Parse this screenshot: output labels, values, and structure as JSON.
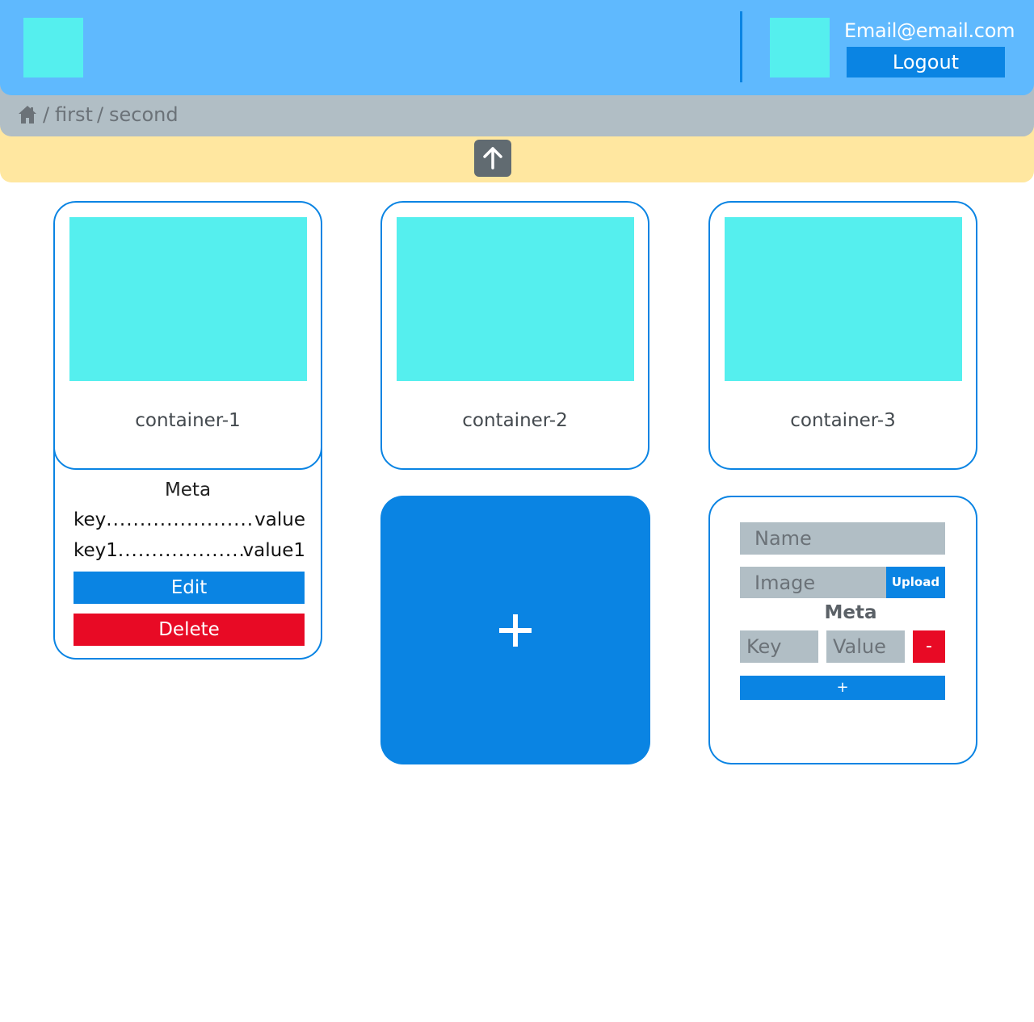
{
  "header": {
    "email": "Email@email.com",
    "logout_label": "Logout"
  },
  "breadcrumb": {
    "separator": "/",
    "items": [
      "first",
      "second"
    ]
  },
  "cards": [
    {
      "title": "container-1"
    },
    {
      "title": "container-2"
    },
    {
      "title": "container-3"
    }
  ],
  "meta_panel": {
    "title": "Meta",
    "rows": [
      {
        "key": "key",
        "dots": " ........................ ",
        "value": "value"
      },
      {
        "key": "key1",
        "dots": "........................",
        "value": "value1"
      }
    ],
    "edit_label": "Edit",
    "delete_label": "Delete"
  },
  "add_card": {
    "label": "+"
  },
  "form": {
    "name_placeholder": "Name",
    "image_placeholder": "Image",
    "upload_label": "Upload",
    "meta_title": "Meta",
    "key_placeholder": "Key",
    "value_placeholder": "Value",
    "remove_label": "-",
    "add_meta_label": "+"
  },
  "colors": {
    "header_bg": "#5fb9fe",
    "breadcrumb_bg": "#b1bec5",
    "upbar_bg": "#ffe7a0",
    "accent": "#0a84e3",
    "danger": "#e80a25",
    "placeholder_image": "#55efee"
  }
}
